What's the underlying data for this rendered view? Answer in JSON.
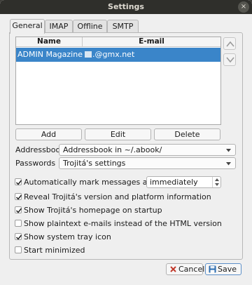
{
  "window": {
    "title": "Settings",
    "close_glyph": "×"
  },
  "tabs": [
    {
      "label": "General"
    },
    {
      "label": "IMAP"
    },
    {
      "label": "Offline"
    },
    {
      "label": "SMTP"
    }
  ],
  "accounts_table": {
    "columns": [
      "Name",
      "E-mail"
    ],
    "rows": [
      {
        "name": "ADMIN Magazine",
        "email": ".@gmx.net"
      }
    ]
  },
  "account_buttons": {
    "add": "Add",
    "edit": "Edit",
    "delete": "Delete"
  },
  "addressbook": {
    "label": "Addressbook",
    "value": "Addressbook in ~/.abook/"
  },
  "passwords": {
    "label": "Passwords",
    "value": "Trojitá's settings"
  },
  "options": {
    "mark_read": {
      "label": "Automatically mark messages as read",
      "checked": true,
      "timing": "immediately"
    },
    "reveal_version": {
      "label": "Reveal Trojitá's version and platform information",
      "checked": true
    },
    "homepage": {
      "label": "Show Trojitá's homepage on startup",
      "checked": true
    },
    "plaintext": {
      "label": "Show plaintext e-mails instead of the HTML version",
      "checked": false
    },
    "tray_icon": {
      "label": "Show system tray icon",
      "checked": true
    },
    "start_minimized": {
      "label": "Start minimized",
      "checked": false
    }
  },
  "footer": {
    "cancel": "Cancel",
    "save": "Save"
  },
  "colors": {
    "selection": "#3a85c9",
    "titlebar": "#2f2f2b",
    "cancel_icon": "#c0392b",
    "save_icon": "#2b6cb0"
  }
}
